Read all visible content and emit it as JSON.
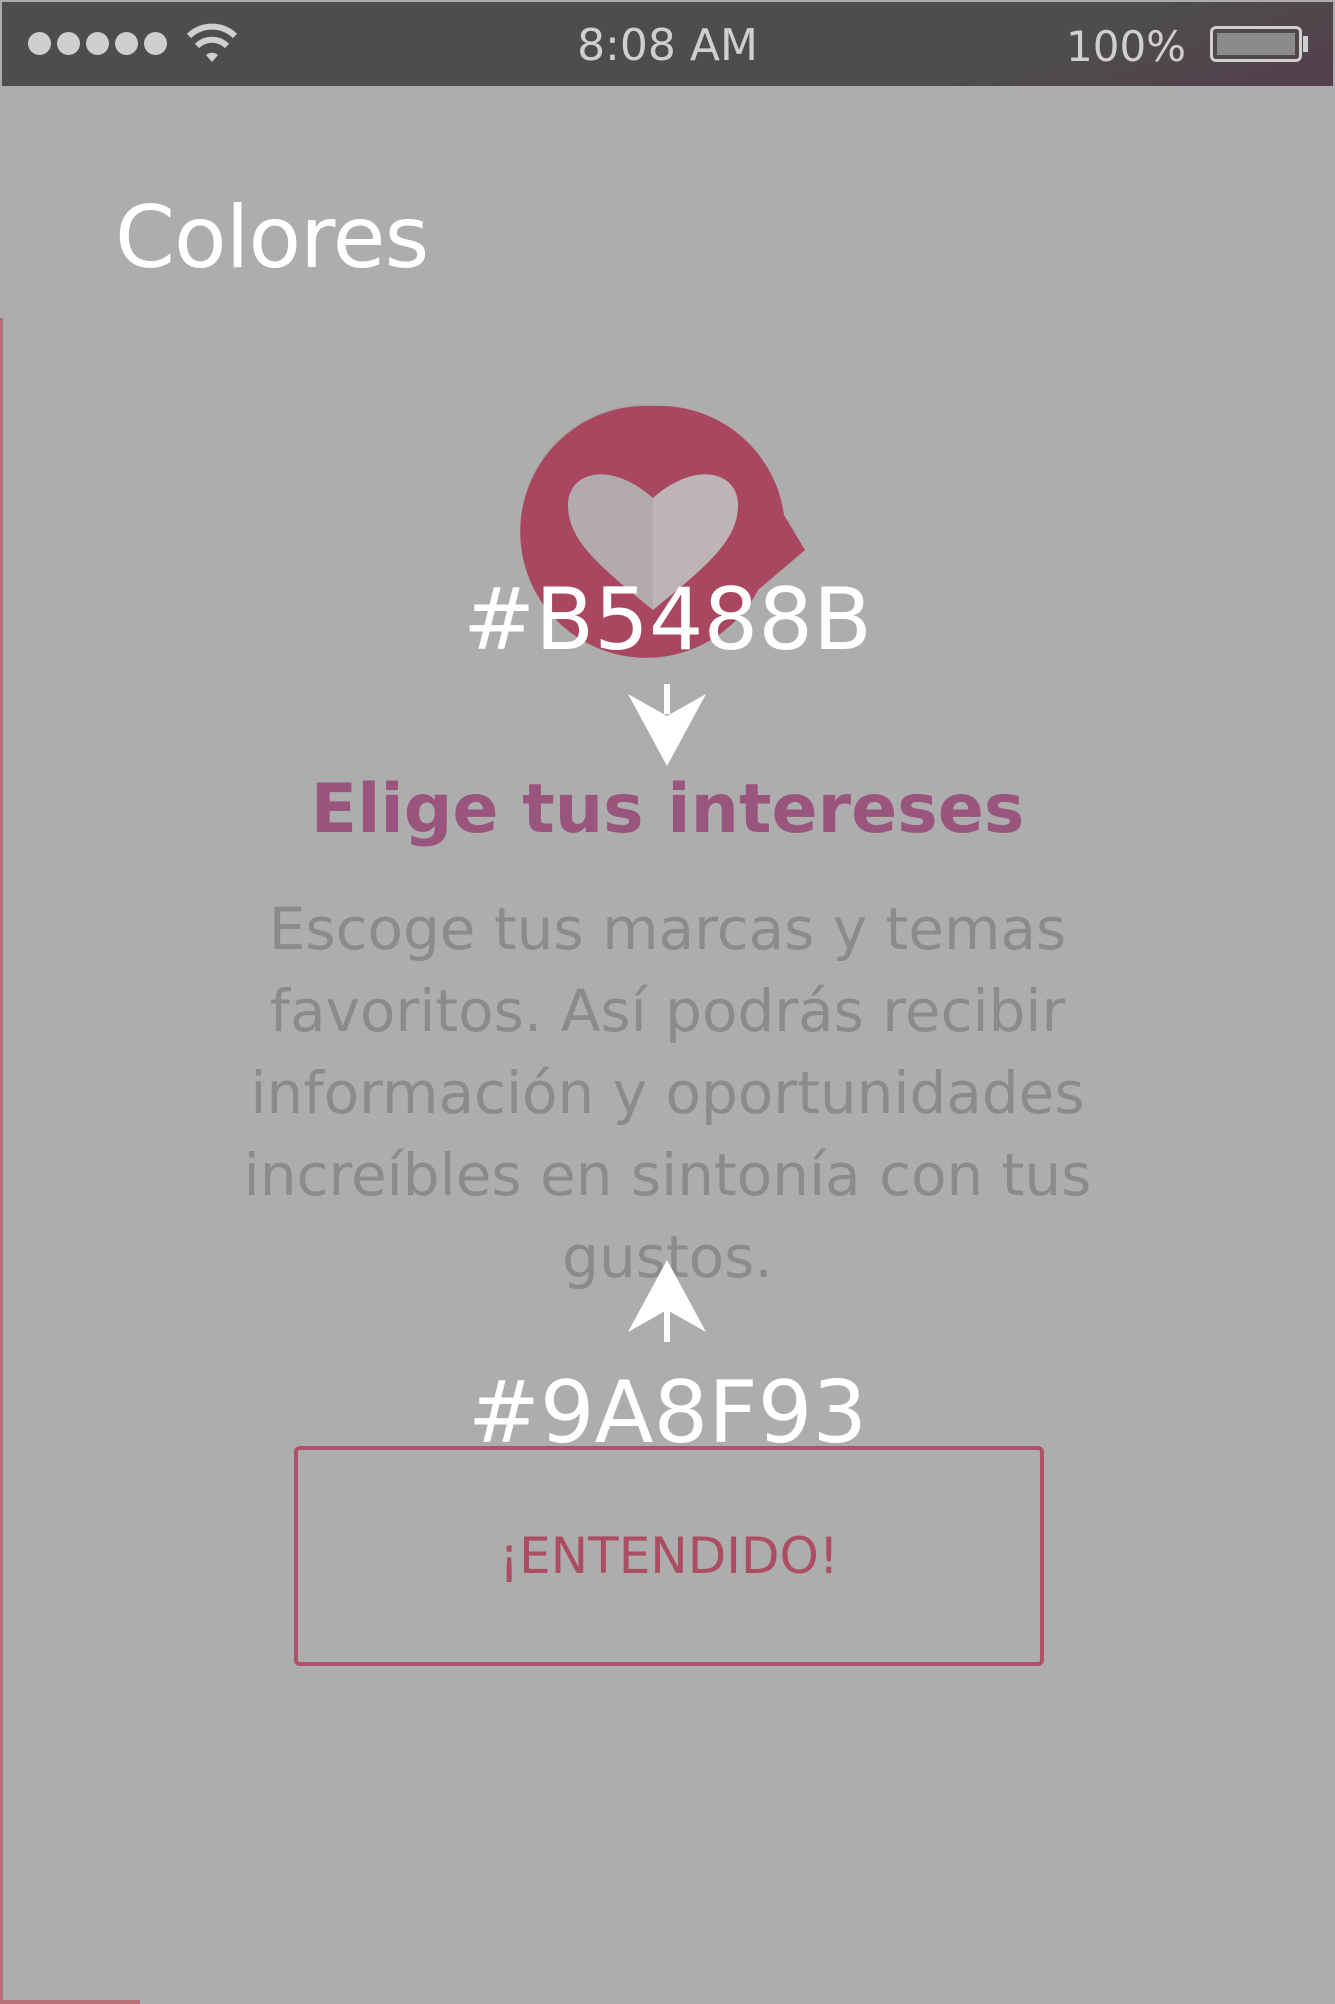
{
  "status_bar": {
    "time": "8:08 AM",
    "battery_percent": "100%",
    "signal_dots": 5,
    "battery_level": 1.0
  },
  "screen": {
    "title": "Colores"
  },
  "annotations": {
    "heading_color_label": "#B5488B",
    "body_color_label": "#9A8F93"
  },
  "content": {
    "heading": "Elige tus intereses",
    "body": "Escoge tus marcas y temas favoritos. Así podrás recibir información y oportunidades increíbles en sintonía con tus gustos.",
    "button_label": "¡ENTENDIDO!"
  },
  "colors": {
    "accent": "#B5488B",
    "body_text": "#9A8F93",
    "logo": "#b84f6a",
    "button_border": "#b2506a"
  }
}
